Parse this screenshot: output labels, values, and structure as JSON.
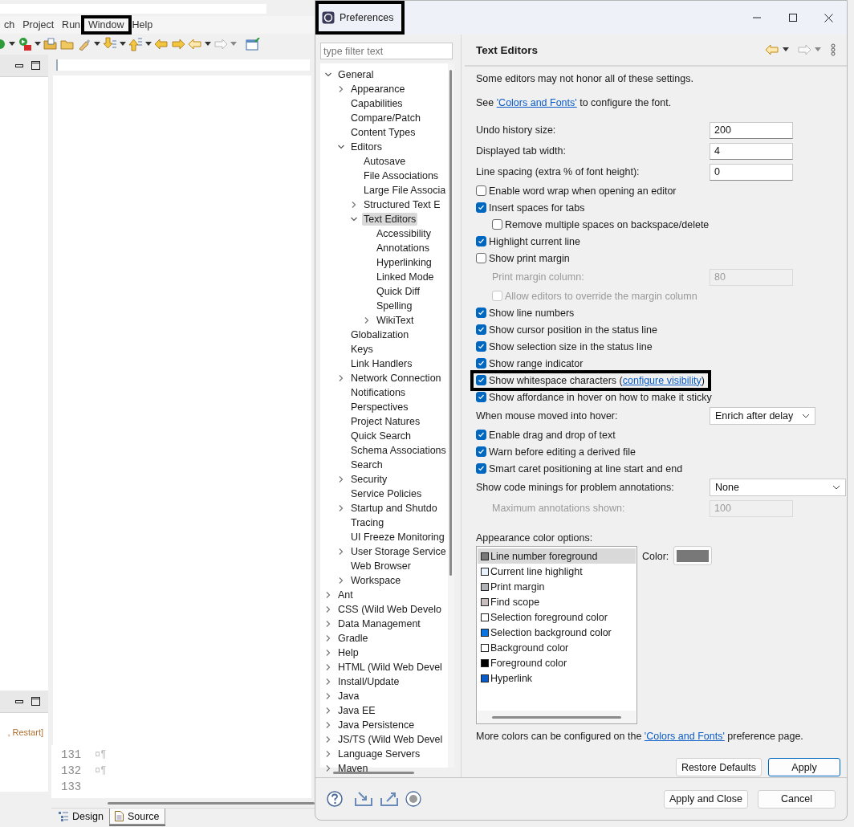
{
  "ide": {
    "menu": [
      {
        "label": "ch",
        "highlighted": false
      },
      {
        "label": "Project",
        "highlighted": false
      },
      {
        "label": "Run",
        "highlighted": false
      },
      {
        "label": "Window",
        "highlighted": true
      },
      {
        "label": "Help",
        "highlighted": false
      }
    ],
    "console_text": ", Restart]",
    "code_lines": [
      {
        "number": "131",
        "text": "¤¶"
      },
      {
        "number": "132",
        "text": "¤¶"
      },
      {
        "number": "133"
      }
    ],
    "editor_tabs": [
      {
        "label": "Design",
        "kind": "tree",
        "selected": false
      },
      {
        "label": "Source",
        "kind": "page",
        "selected": true
      }
    ]
  },
  "dialog": {
    "title": "Preferences",
    "title_highlighted": true,
    "filter": {
      "placeholder": "type filter text"
    },
    "tree": [
      {
        "label": "General",
        "expanded": true,
        "selected": false,
        "children": [
          {
            "label": "Appearance",
            "expanded": false,
            "selected": false
          },
          {
            "label": "Capabilities",
            "selected": false
          },
          {
            "label": "Compare/Patch",
            "selected": false
          },
          {
            "label": "Content Types",
            "selected": false
          },
          {
            "label": "Editors",
            "expanded": true,
            "selected": false,
            "children": [
              {
                "label": "Autosave",
                "selected": false
              },
              {
                "label": "File Associations",
                "selected": false
              },
              {
                "label": "Large File Associa",
                "selected": false
              },
              {
                "label": "Structured Text E",
                "expanded": false,
                "selected": false
              },
              {
                "label": "Text Editors",
                "expanded": true,
                "selected": true,
                "children": [
                  {
                    "label": "Accessibility",
                    "selected": false
                  },
                  {
                    "label": "Annotations",
                    "selected": false
                  },
                  {
                    "label": "Hyperlinking",
                    "selected": false
                  },
                  {
                    "label": "Linked Mode",
                    "selected": false
                  },
                  {
                    "label": "Quick Diff",
                    "selected": false
                  },
                  {
                    "label": "Spelling",
                    "selected": false
                  },
                  {
                    "label": "WikiText",
                    "expanded": false,
                    "selected": false
                  }
                ]
              }
            ]
          },
          {
            "label": "Globalization",
            "selected": false
          },
          {
            "label": "Keys",
            "selected": false
          },
          {
            "label": "Link Handlers",
            "selected": false
          },
          {
            "label": "Network Connection",
            "expanded": false,
            "selected": false
          },
          {
            "label": "Notifications",
            "selected": false
          },
          {
            "label": "Perspectives",
            "selected": false
          },
          {
            "label": "Project Natures",
            "selected": false
          },
          {
            "label": "Quick Search",
            "selected": false
          },
          {
            "label": "Schema Associations",
            "selected": false
          },
          {
            "label": "Search",
            "selected": false
          },
          {
            "label": "Security",
            "expanded": false,
            "selected": false
          },
          {
            "label": "Service Policies",
            "selected": false
          },
          {
            "label": "Startup and Shutdo",
            "expanded": false,
            "selected": false
          },
          {
            "label": "Tracing",
            "selected": false
          },
          {
            "label": "UI Freeze Monitoring",
            "selected": false
          },
          {
            "label": "User Storage Service",
            "expanded": false,
            "selected": false
          },
          {
            "label": "Web Browser",
            "selected": false
          },
          {
            "label": "Workspace",
            "expanded": false,
            "selected": false
          }
        ]
      },
      {
        "label": "Ant",
        "expanded": false,
        "selected": false
      },
      {
        "label": "CSS (Wild Web Develo",
        "expanded": false,
        "selected": false
      },
      {
        "label": "Data Management",
        "expanded": false,
        "selected": false
      },
      {
        "label": "Gradle",
        "expanded": false,
        "selected": false
      },
      {
        "label": "Help",
        "expanded": false,
        "selected": false
      },
      {
        "label": "HTML (Wild Web Devel",
        "expanded": false,
        "selected": false
      },
      {
        "label": "Install/Update",
        "expanded": false,
        "selected": false
      },
      {
        "label": "Java",
        "expanded": false,
        "selected": false
      },
      {
        "label": "Java EE",
        "expanded": false,
        "selected": false
      },
      {
        "label": "Java Persistence",
        "expanded": false,
        "selected": false
      },
      {
        "label": "JS/TS (Wild Web Devel",
        "expanded": false,
        "selected": false
      },
      {
        "label": "Language Servers",
        "expanded": false,
        "selected": false
      },
      {
        "label": "Maven",
        "expanded": false,
        "selected": false
      }
    ],
    "page": {
      "title": "Text Editors",
      "note": "Some editors may not honor all of these settings.",
      "font_note": {
        "before": "See ",
        "link": "'Colors and Fonts'",
        "after": " to configure the font."
      },
      "settings": [
        {
          "kind": "field",
          "label": "Undo history size:",
          "value": "200",
          "disabled": false
        },
        {
          "kind": "field",
          "label": "Displayed tab width:",
          "value": "4",
          "disabled": false
        },
        {
          "kind": "field",
          "label": "Line spacing (extra % of font height):",
          "value": "0",
          "disabled": false
        },
        {
          "kind": "checkbox",
          "label": "Enable word wrap when opening an editor",
          "checked": false,
          "disabled": false
        },
        {
          "kind": "checkbox",
          "label": "Insert spaces for tabs",
          "checked": true,
          "disabled": false,
          "children": [
            {
              "kind": "checkbox",
              "label": "Remove multiple spaces on backspace/delete",
              "checked": false,
              "disabled": false
            }
          ]
        },
        {
          "kind": "checkbox",
          "label": "Highlight current line",
          "checked": true,
          "disabled": false
        },
        {
          "kind": "checkbox",
          "label": "Show print margin",
          "checked": false,
          "disabled": false,
          "children": [
            {
              "kind": "field",
              "label": "Print margin column:",
              "value": "80",
              "disabled": true
            },
            {
              "kind": "checkbox",
              "label": "Allow editors to override the margin column",
              "checked": false,
              "disabled": true
            }
          ]
        },
        {
          "kind": "checkbox",
          "label": "Show line numbers",
          "checked": true,
          "disabled": false
        },
        {
          "kind": "checkbox",
          "label": "Show cursor position in the status line",
          "checked": true,
          "disabled": false
        },
        {
          "kind": "checkbox",
          "label": "Show selection size in the status line",
          "checked": true,
          "disabled": false
        },
        {
          "kind": "checkbox",
          "label": "Show range indicator",
          "checked": true,
          "disabled": false
        },
        {
          "kind": "checkbox",
          "label": "Show whitespace characters",
          "checked": true,
          "disabled": false,
          "highlighted": true,
          "link": {
            "before": "(",
            "text": "configure visibility",
            "after": ")"
          }
        },
        {
          "kind": "checkbox",
          "label": "Show affordance in hover on how to make it sticky",
          "checked": true,
          "disabled": false
        },
        {
          "kind": "select",
          "label": "When mouse moved into hover:",
          "value": "Enrich after delay"
        },
        {
          "kind": "checkbox",
          "label": "Enable drag and drop of text",
          "checked": true,
          "disabled": false
        },
        {
          "kind": "checkbox",
          "label": "Warn before editing a derived file",
          "checked": true,
          "disabled": false
        },
        {
          "kind": "checkbox",
          "label": "Smart caret positioning at line start and end",
          "checked": true,
          "disabled": false
        },
        {
          "kind": "select",
          "label": "Show code minings for problem annotations:",
          "value": "None",
          "children": [
            {
              "kind": "field",
              "label": "Maximum annotations shown:",
              "value": "100",
              "disabled": true
            }
          ]
        }
      ],
      "colors": {
        "label": "Appearance color options:",
        "color_label": "Color:",
        "items": [
          {
            "label": "Line number foreground",
            "color": "#787878",
            "selected": true
          },
          {
            "label": "Current line highlight",
            "color": "#e8f2fe",
            "selected": false
          },
          {
            "label": "Print margin",
            "color": "#b0b4b9",
            "selected": false
          },
          {
            "label": "Find scope",
            "color": "#c8bebe",
            "selected": false
          },
          {
            "label": "Selection foreground color",
            "color": "#ffffff",
            "selected": false
          },
          {
            "label": "Selection background color",
            "color": "#0a74e0",
            "selected": false
          },
          {
            "label": "Background color",
            "color": "#ffffff",
            "selected": false
          },
          {
            "label": "Foreground color",
            "color": "#000000",
            "selected": false
          },
          {
            "label": "Hyperlink",
            "color": "#0a5cc8",
            "selected": false
          }
        ]
      },
      "more_colors": {
        "before": "More colors can be configured on the ",
        "link": "'Colors and Fonts'",
        "after": " preference page."
      },
      "buttons": [
        {
          "label": "Restore Defaults",
          "default": false
        },
        {
          "label": "Apply",
          "default": true
        }
      ]
    },
    "footer_buttons": [
      {
        "label": "Apply and Close",
        "default": false
      },
      {
        "label": "Cancel",
        "default": false
      }
    ]
  }
}
